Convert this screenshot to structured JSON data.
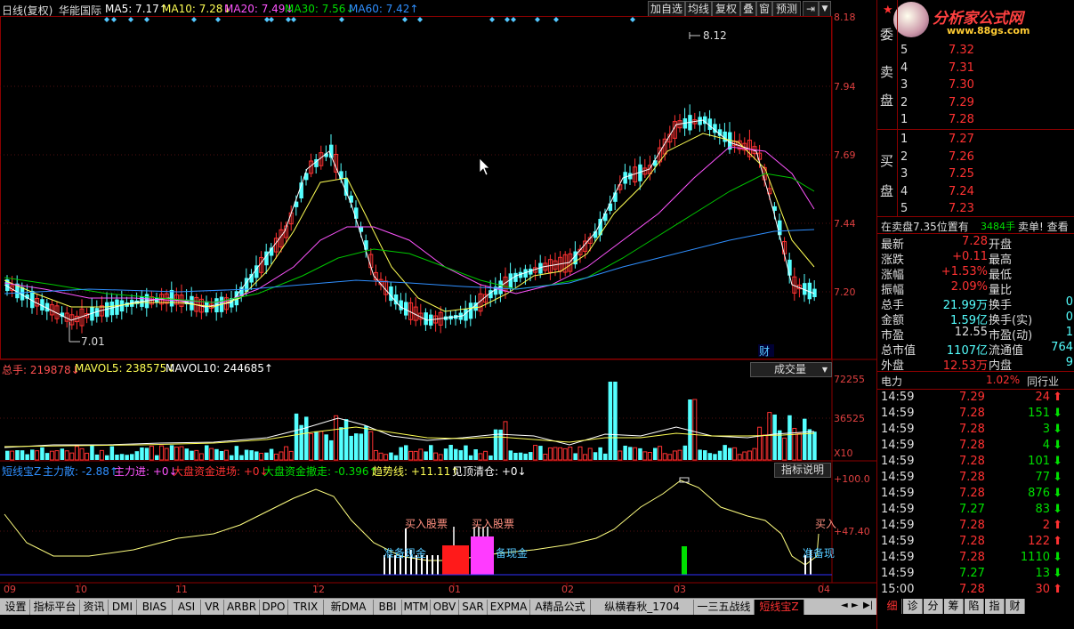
{
  "topbar": {
    "period": "日线(复权)",
    "stock": "华能国际",
    "ma5": "MA5: 7.17↑",
    "ma10": "MA10: 7.28↓",
    "ma20": "MA20: 7.49↓",
    "ma30": "MA30: 7.56↓",
    "ma60": "MA60: 7.42↑",
    "buttons": [
      "加自选",
      "均线",
      "复权",
      "叠",
      "窗",
      "预测"
    ]
  },
  "price_axis": [
    "8.18",
    "7.94",
    "7.69",
    "7.44",
    "7.20"
  ],
  "chart_annotations": {
    "high": "8.12",
    "low": "7.01",
    "cai": "财"
  },
  "volume": {
    "header_total": "总手: 219878↓",
    "header_mavol5": "MAVOL5: 238575↓",
    "header_mavol10": "MAVOL10: 244685↑",
    "dropdown": "成交量",
    "axis": [
      "72255",
      "36525",
      "X10"
    ]
  },
  "indicator": {
    "name": "短线宝Z",
    "zlsan": "主力散: -2.88↑",
    "zljin": "主力进: +0↓",
    "dpjc": "大盘资金进场: +0↓",
    "dpcz": "大盘资金撤走: -0.396↑",
    "qsx": "趋势线: +11.11↑",
    "jdqc": "见顶清仓: +0↓",
    "explain": "指标说明",
    "axis": [
      "+100.0",
      "+47.40"
    ],
    "labels": {
      "buy1": "买入股票",
      "buy2": "买入股票",
      "buy3": "买入",
      "cash1": "准备现金",
      "cash2": "备现金",
      "cash3": "准备现"
    }
  },
  "x_axis": [
    "09",
    "10",
    "11",
    "12",
    "01",
    "02",
    "03",
    "04"
  ],
  "right_panel": {
    "logo_text": "分析家公式网",
    "logo_url": "www.88gs.com",
    "wei": "委",
    "mai_lbl": "卖",
    "pan_lbl": "盘",
    "mai2_lbl": "买",
    "pan2_lbl": "盘",
    "sell": [
      {
        "n": "5",
        "p": "7.32"
      },
      {
        "n": "4",
        "p": "7.31"
      },
      {
        "n": "3",
        "p": "7.30"
      },
      {
        "n": "2",
        "p": "7.29"
      },
      {
        "n": "1",
        "p": "7.28"
      }
    ],
    "buy": [
      {
        "n": "1",
        "p": "7.27"
      },
      {
        "n": "2",
        "p": "7.26"
      },
      {
        "n": "3",
        "p": "7.25"
      },
      {
        "n": "4",
        "p": "7.24"
      },
      {
        "n": "5",
        "p": "7.23"
      }
    ],
    "notice_a": "在卖盘7.35位置有",
    "notice_b": "3484手",
    "notice_c": "卖单! 查看",
    "quote": [
      {
        "l": "最新",
        "v": "7.28",
        "l2": "开盘",
        "v2": ""
      },
      {
        "l": "涨跌",
        "v": "+0.11",
        "l2": "最高",
        "v2": ""
      },
      {
        "l": "涨幅",
        "v": "+1.53%",
        "l2": "最低",
        "v2": ""
      },
      {
        "l": "振幅",
        "v": "2.09%",
        "l2": "量比",
        "v2": ""
      },
      {
        "l": "总手",
        "v": "21.99万",
        "l2": "换手",
        "v2": "0"
      },
      {
        "l": "金额",
        "v": "1.59亿",
        "l2": "换手(实)",
        "v2": "0"
      },
      {
        "l": "市盈",
        "v": "12.55",
        "l2": "市盈(动)",
        "v2": "1"
      },
      {
        "l": "总市值",
        "v": "1107亿",
        "l2": "流通值",
        "v2": "764"
      },
      {
        "l": "外盘",
        "v": "12.53万",
        "l2": "内盘",
        "v2": "9"
      }
    ],
    "sector": "电力",
    "sector_pct": "1.02%",
    "peer": "同行业",
    "ticks": [
      {
        "t": "14:59",
        "p": "7.29",
        "v": "24",
        "d": "up"
      },
      {
        "t": "14:59",
        "p": "7.28",
        "v": "151",
        "d": "down"
      },
      {
        "t": "14:59",
        "p": "7.28",
        "v": "3",
        "d": "down"
      },
      {
        "t": "14:59",
        "p": "7.28",
        "v": "4",
        "d": "down"
      },
      {
        "t": "14:59",
        "p": "7.28",
        "v": "101",
        "d": "down"
      },
      {
        "t": "14:59",
        "p": "7.28",
        "v": "77",
        "d": "down"
      },
      {
        "t": "14:59",
        "p": "7.28",
        "v": "876",
        "d": "down"
      },
      {
        "t": "14:59",
        "p": "7.27",
        "v": "83",
        "d": "down"
      },
      {
        "t": "14:59",
        "p": "7.28",
        "v": "2",
        "d": "up"
      },
      {
        "t": "14:59",
        "p": "7.28",
        "v": "122",
        "d": "up"
      },
      {
        "t": "14:59",
        "p": "7.28",
        "v": "1110",
        "d": "down"
      },
      {
        "t": "14:59",
        "p": "7.27",
        "v": "13",
        "d": "down"
      },
      {
        "t": "15:00",
        "p": "7.28",
        "v": "30",
        "d": "up"
      }
    ]
  },
  "bottom_tabs": [
    "设置",
    "指标平台",
    "资讯",
    "DMI",
    "BIAS",
    "ASI",
    "VR",
    "ARBR",
    "DPO",
    "TRIX",
    "新DMA",
    "BBI",
    "MTM",
    "OBV",
    "SAR",
    "EXPMA",
    "A精品公式",
    "纵横春秋_1704",
    "一三五战线",
    "短线宝Z"
  ],
  "right_tabs": [
    "细",
    "诊",
    "分",
    "筹",
    "陷",
    "指",
    "财"
  ],
  "colors": {
    "up": "#ff3232",
    "down": "#54ffff",
    "yellow": "#ffff54",
    "magenta": "#ff54ff",
    "green": "#00c800",
    "blue": "#2f8fff"
  }
}
